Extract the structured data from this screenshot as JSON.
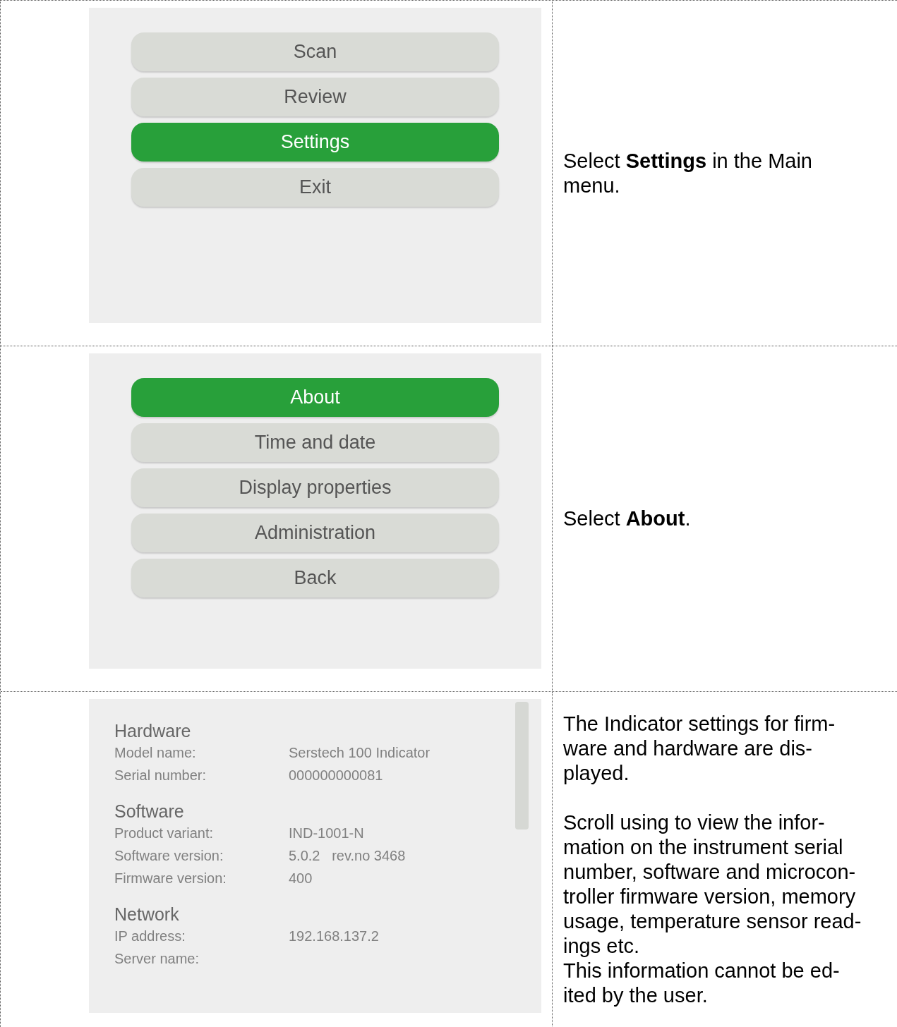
{
  "rows": [
    {
      "screen": {
        "kind": "menu",
        "buttons": [
          {
            "label": "Scan",
            "selected": false
          },
          {
            "label": "Review",
            "selected": false
          },
          {
            "label": "Settings",
            "selected": true
          },
          {
            "label": "Exit",
            "selected": false
          }
        ]
      },
      "description": [
        [
          "Select **Settings** in the Main",
          "menu."
        ]
      ]
    },
    {
      "screen": {
        "kind": "menu",
        "buttons": [
          {
            "label": "About",
            "selected": true
          },
          {
            "label": "Time and date",
            "selected": false
          },
          {
            "label": "Display properties",
            "selected": false
          },
          {
            "label": "Administration",
            "selected": false
          },
          {
            "label": "Back",
            "selected": false
          }
        ]
      },
      "description": [
        [
          "Select **About**."
        ]
      ]
    },
    {
      "screen": {
        "kind": "info",
        "sections": [
          {
            "title": "Hardware",
            "fields": [
              {
                "label": "Model name:",
                "value": "Serstech 100 Indicator"
              },
              {
                "label": "Serial number:",
                "value": "000000000081"
              }
            ]
          },
          {
            "title": "Software",
            "fields": [
              {
                "label": "Product variant:",
                "value": "IND-1001-N"
              },
              {
                "label": "Software version:",
                "value": "5.0.2   rev.no 3468"
              },
              {
                "label": "Firmware version:",
                "value": "400"
              }
            ]
          },
          {
            "title": "Network",
            "fields": [
              {
                "label": "IP address:",
                "value": "192.168.137.2"
              },
              {
                "label": "Server name:"
              }
            ]
          }
        ]
      },
      "description": [
        [
          "The Indicator settings for firm-",
          "ware and hardware are dis-",
          "played."
        ],
        [
          "Scroll using to view the infor-",
          "mation on the instrument serial",
          "number, software and microcon-",
          "troller firmware version, memory",
          "usage, temperature sensor read-",
          "ings etc.",
          "This information cannot be ed-",
          "ited by the user."
        ]
      ]
    }
  ]
}
